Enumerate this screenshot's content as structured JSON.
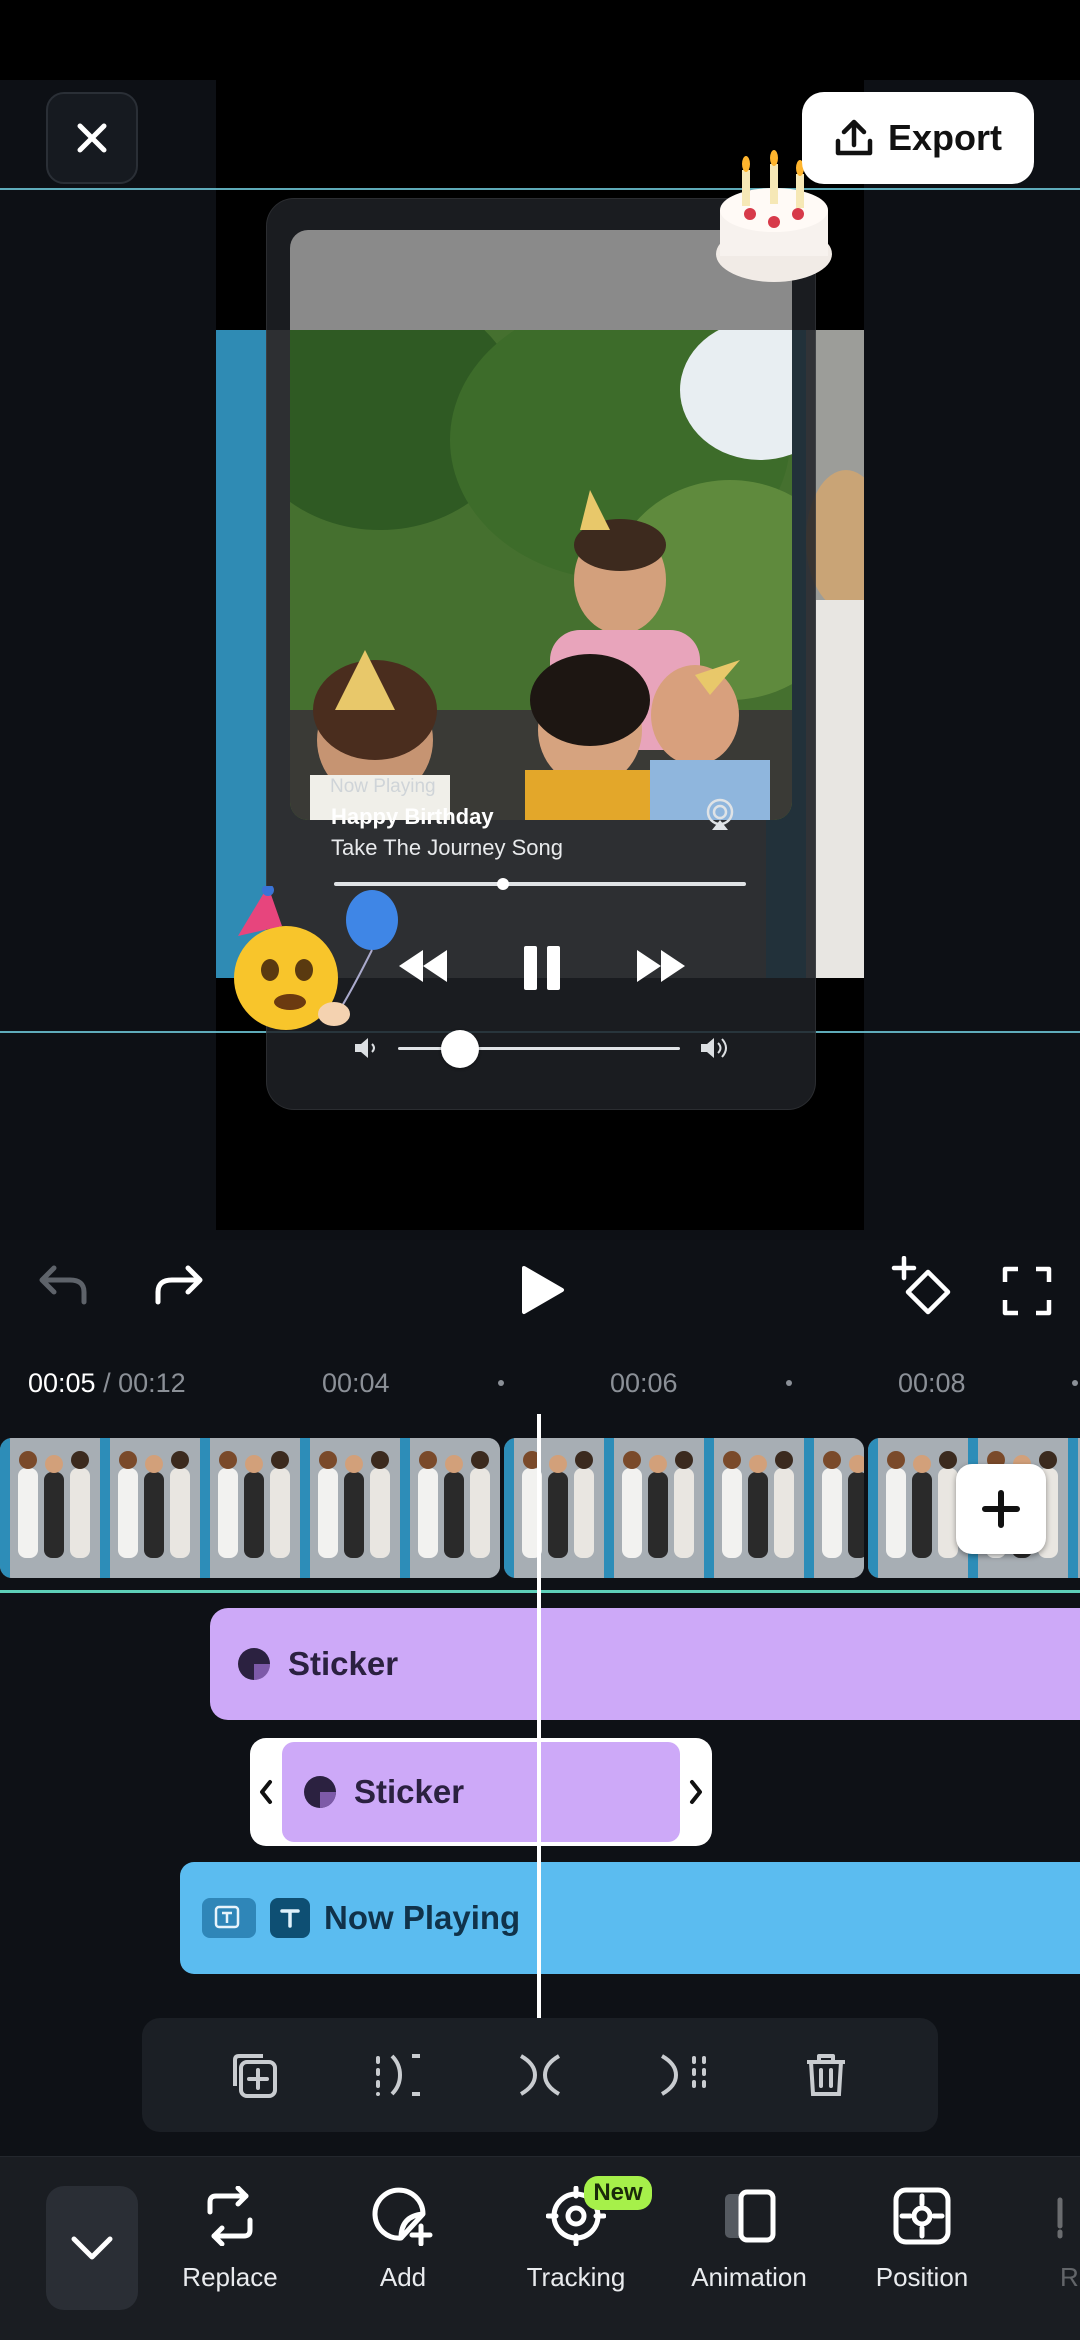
{
  "header": {
    "export_label": "Export"
  },
  "player": {
    "now_playing_label": "Now Playing",
    "song_title": "Happy Birthday",
    "song_artist": "Take The Journey Song",
    "progress_fraction": 0.41,
    "volume_fraction": 0.22
  },
  "timeline": {
    "current_time": "00:05",
    "separator": " / ",
    "total_time": "00:12",
    "ticks": [
      "00:04",
      "00:06",
      "00:08"
    ]
  },
  "tracks": {
    "sticker_1_label": "Sticker",
    "sticker_2_label": "Sticker",
    "text_label": "Now Playing"
  },
  "bottom_toolbar": {
    "items": [
      {
        "label": "Replace",
        "icon": "replace-icon"
      },
      {
        "label": "Add",
        "icon": "add-sticker-icon"
      },
      {
        "label": "Tracking",
        "icon": "tracking-icon",
        "badge": "New"
      },
      {
        "label": "Animation",
        "icon": "animation-icon"
      },
      {
        "label": "Position",
        "icon": "position-icon"
      },
      {
        "label": "R",
        "icon": "partial-icon"
      }
    ]
  },
  "colors": {
    "accent_cyan": "#6fc8d8",
    "sticker_purple": "#cda9f8",
    "text_blue": "#5bbcf0",
    "new_badge": "#a6f04a"
  }
}
